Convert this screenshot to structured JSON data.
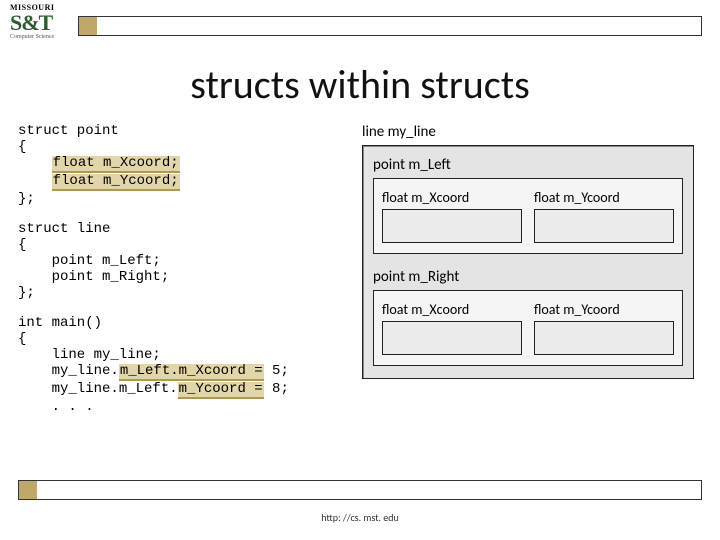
{
  "logo": {
    "line1": "MISSOURI",
    "line2": "S&T",
    "line3": "Computer Science"
  },
  "title": "structs within structs",
  "code": {
    "block1": {
      "l1": "struct point",
      "l2": "{",
      "l3_pre": "    ",
      "l3_hl": "float m_Xcoord;",
      "l4_pre": "    ",
      "l4_hl": "float m_Ycoord;",
      "l5": "};"
    },
    "block2": {
      "l1": "struct line",
      "l2": "{",
      "l3": "    point m_Left;",
      "l4": "    point m_Right;",
      "l5": "};"
    },
    "block3": {
      "l1": "int main()",
      "l2": "{",
      "l3": "    line my_line;",
      "l4_pre": "    my_line.",
      "l4_hl": "m_Left.m_Xcoord =",
      "l4_post": " 5;",
      "l5_pre": "    my_line.m_Left.",
      "l5_hl": "m_Ycoord =",
      "l5_post": " 8;",
      "l6": "    . . ."
    }
  },
  "diagram": {
    "outer_label": "line my_line",
    "p1": {
      "label": "point m_Left",
      "a": "float m_Xcoord",
      "b": "float m_Ycoord"
    },
    "p2": {
      "label": "point m_Right",
      "a": "float m_Xcoord",
      "b": "float m_Ycoord"
    }
  },
  "footer": "http: //cs. mst. edu"
}
